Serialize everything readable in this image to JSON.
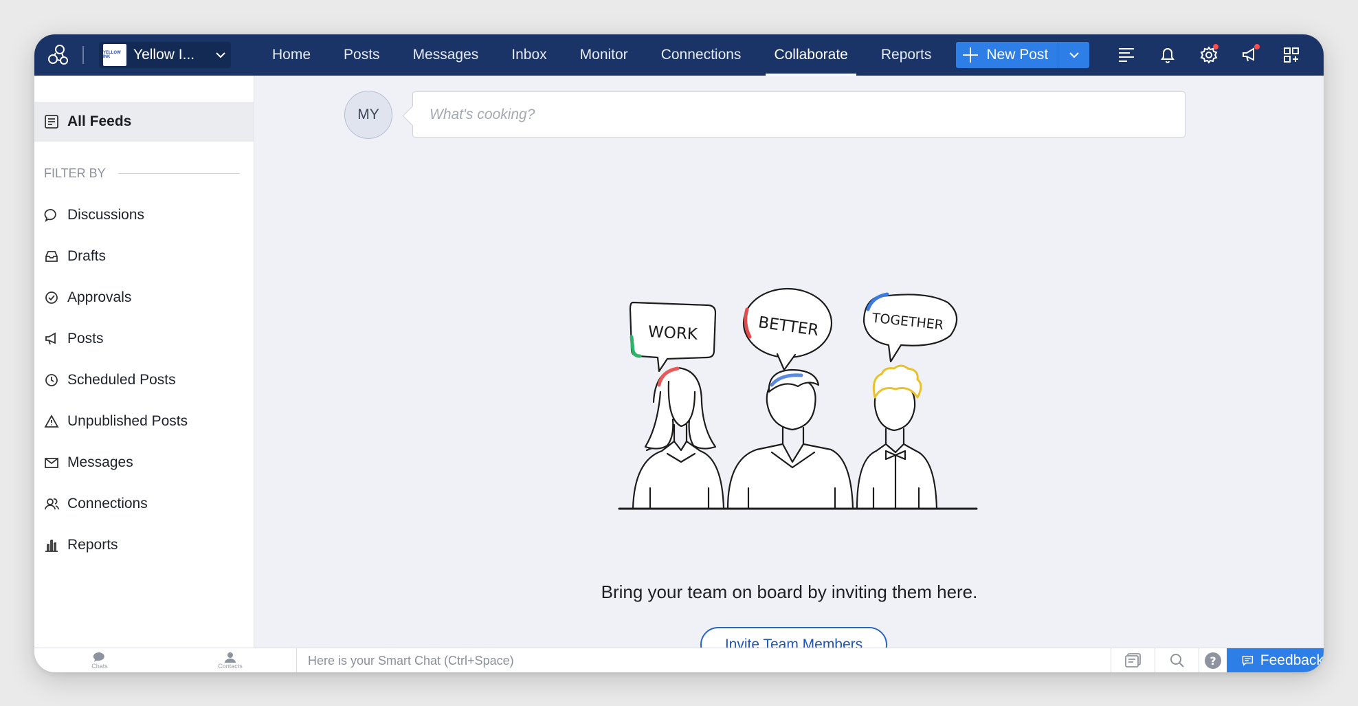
{
  "brand": {
    "org_name": "Yellow I...",
    "logo_text": "YELLOW INK"
  },
  "nav": {
    "items": [
      {
        "label": "Home"
      },
      {
        "label": "Posts"
      },
      {
        "label": "Messages"
      },
      {
        "label": "Inbox"
      },
      {
        "label": "Monitor"
      },
      {
        "label": "Connections"
      },
      {
        "label": "Collaborate",
        "active": true
      },
      {
        "label": "Reports"
      }
    ],
    "new_post_label": "New Post"
  },
  "sidebar": {
    "all_feeds": "All Feeds",
    "filter_heading": "FILTER BY",
    "items": [
      {
        "label": "Discussions",
        "icon": "chat-bubble-icon"
      },
      {
        "label": "Drafts",
        "icon": "inbox-tray-icon"
      },
      {
        "label": "Approvals",
        "icon": "check-circle-icon"
      },
      {
        "label": "Posts",
        "icon": "megaphone-icon"
      },
      {
        "label": "Scheduled Posts",
        "icon": "clock-icon"
      },
      {
        "label": "Unpublished Posts",
        "icon": "warning-icon"
      },
      {
        "label": "Messages",
        "icon": "envelope-icon"
      },
      {
        "label": "Connections",
        "icon": "people-icon"
      },
      {
        "label": "Reports",
        "icon": "bar-chart-icon"
      }
    ]
  },
  "main": {
    "avatar_initials": "MY",
    "compose_placeholder": "What's cooking?",
    "bubbles": [
      "WORK",
      "BETTER",
      "TOGETHER"
    ],
    "empty_message": "Bring your team on board by inviting them here.",
    "invite_label": "Invite Team Members"
  },
  "bottom": {
    "tabs": [
      {
        "label": "Chats"
      },
      {
        "label": "Contacts"
      }
    ],
    "smart_chat_placeholder": "Here is your Smart Chat (Ctrl+Space)",
    "feedback_label": "Feedback"
  },
  "colors": {
    "topbar": "#1b3467",
    "accent": "#2e7ee8",
    "notify": "#ff4d4d"
  }
}
